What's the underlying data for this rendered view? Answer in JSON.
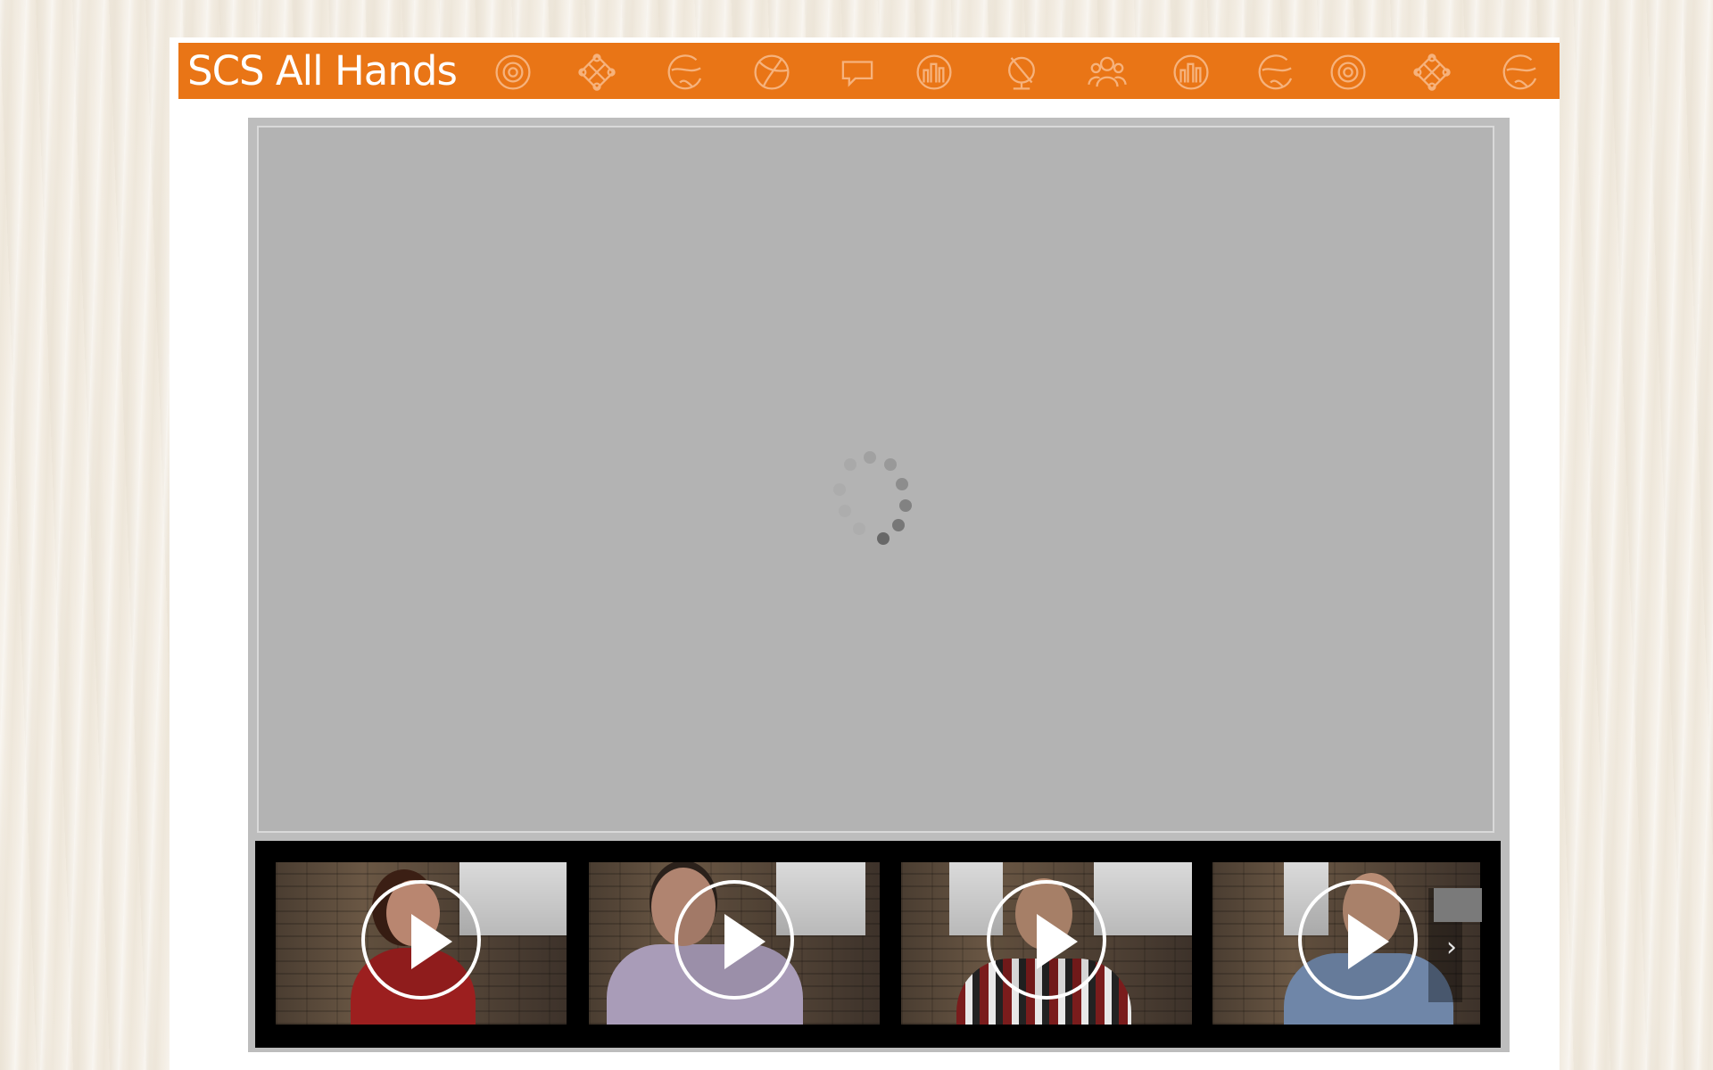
{
  "header": {
    "title": "SCS All Hands",
    "background_color": "#e97516",
    "decorative_icons": [
      "target-icon",
      "knot-icon",
      "globe-icon",
      "ball-icon",
      "speech-bubble-icon",
      "city-globe-icon",
      "desk-globe-icon",
      "people-icon",
      "city-globe-icon",
      "globe-icon",
      "target-icon",
      "knot-icon",
      "globe-icon"
    ]
  },
  "player": {
    "state": "loading",
    "spinner_icon": "loading-spinner-icon"
  },
  "playlist": {
    "items": [
      {
        "thumbnail": "video-thumbnail",
        "action_icon": "play-icon"
      },
      {
        "thumbnail": "video-thumbnail",
        "action_icon": "play-icon"
      },
      {
        "thumbnail": "video-thumbnail",
        "action_icon": "play-icon"
      },
      {
        "thumbnail": "video-thumbnail",
        "action_icon": "play-icon"
      }
    ],
    "next_icon": "chevron-right-icon",
    "next_glyph": "›"
  }
}
